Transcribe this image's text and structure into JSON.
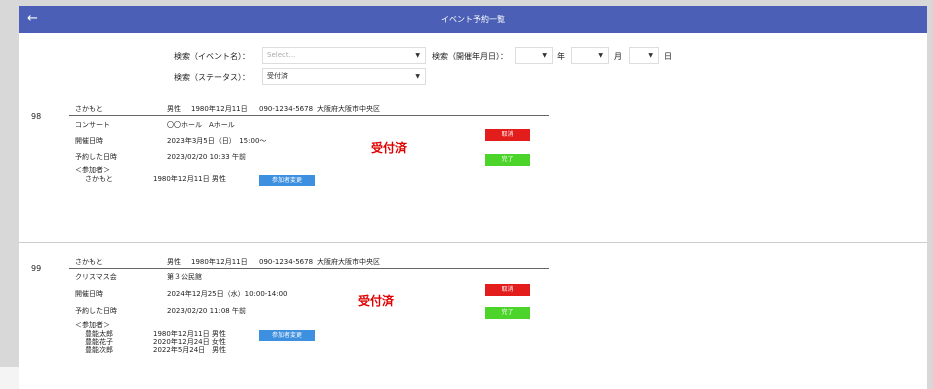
{
  "header": {
    "back_icon": "←",
    "title": "イベント予約一覧"
  },
  "filters": {
    "event_label": "検索（イベント名）：",
    "event_placeholder": "Select...",
    "date_label": "検索（開催年月日）：",
    "year_unit": "年",
    "month_unit": "月",
    "day_unit": "日",
    "status_label": "検索（ステータス）：",
    "status_value": "受付済",
    "arrow": "▼"
  },
  "records": [
    {
      "number": "98",
      "name": "さかもと",
      "gender": "男性",
      "birth": "1980年12月11日",
      "phone": "090-1234-5678",
      "address": "大阪府大阪市中央区",
      "event_name": "コンサート",
      "venue": "〇〇ホール　Aホール",
      "event_date_label": "開催日時",
      "event_date": "2023年3月5日（日）　15:00〜",
      "reserved_label": "予約した日時",
      "reserved_at": "2023/02/20 10:33 午前",
      "participants_label": "＜参加者＞",
      "participants": [
        {
          "name": "さかもと",
          "info": "1980年12月11日 男性"
        }
      ],
      "status": "受付済",
      "cancel_label": "取消",
      "complete_label": "完了",
      "change_label": "参加者変更"
    },
    {
      "number": "99",
      "name": "さかもと",
      "gender": "男性",
      "birth": "1980年12月11日",
      "phone": "090-1234-5678",
      "address": "大阪府大阪市中央区",
      "event_name": "クリスマス会",
      "venue": "第３公民館",
      "event_date_label": "開催日時",
      "event_date": "2024年12月25日（水）10:00-14:00",
      "reserved_label": "予約した日時",
      "reserved_at": "2023/02/20 11:08 午前",
      "participants_label": "＜参加者＞",
      "participants": [
        {
          "name": "豊能太郎",
          "info": "1980年12月11日 男性"
        },
        {
          "name": "豊能花子",
          "info": "2020年12月24日 女性"
        },
        {
          "name": "豊能次郎",
          "info": "2022年5月24日　男性"
        }
      ],
      "status": "受付済",
      "cancel_label": "取消",
      "complete_label": "完了",
      "change_label": "参加者変更"
    }
  ]
}
